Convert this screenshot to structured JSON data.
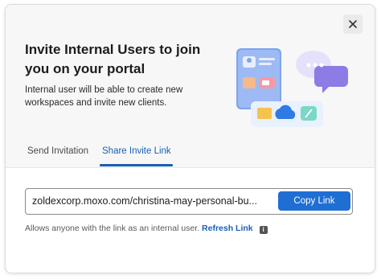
{
  "dialog": {
    "title": "Invite Internal Users to join you on your portal",
    "description": "Internal user will be able to create new workspaces and invite new clients.",
    "close_icon": "close-icon"
  },
  "tabs": [
    {
      "label": "Send Invitation",
      "active": false
    },
    {
      "label": "Share Invite Link",
      "active": true
    }
  ],
  "invite_link": {
    "value": "zoldexcorp.moxo.com/christina-may-personal-bu...",
    "copy_label": "Copy Link"
  },
  "hint": {
    "text": "Allows anyone with the link as an internal user.",
    "refresh_label": "Refresh Link",
    "info_icon": "info-icon"
  },
  "colors": {
    "accent": "#1f6ed4",
    "link": "#1a5fb4",
    "header_bg": "#f7f7f7"
  }
}
